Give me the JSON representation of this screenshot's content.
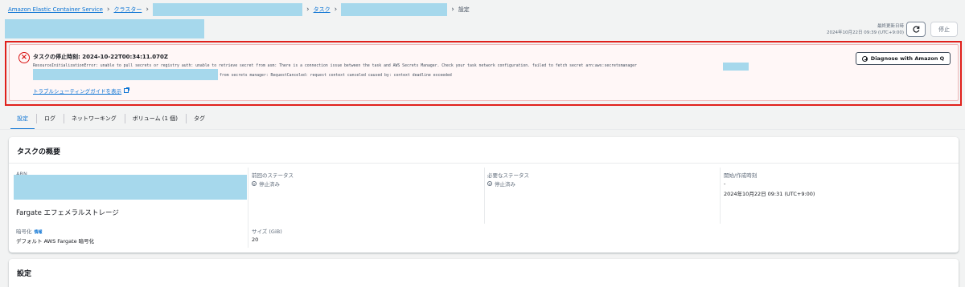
{
  "breadcrumb": {
    "service": "Amazon Elastic Container Service",
    "clusters": "クラスター",
    "tasks": "タスク",
    "current": "設定"
  },
  "header": {
    "last_updated_label": "最終更新日時",
    "last_updated_value": "2024年10月22日 09:39 (UTC+9:00)",
    "stop_label": "停止"
  },
  "alert": {
    "title": "タスクの停止時刻: 2024-10-22T00:34:11.070Z",
    "message_line1": "ResourceInitializationError: unable to pull secrets or registry auth: unable to retrieve secret from asm: There is a connection issue between the task and AWS Secrets Manager. Check your task network configuration. failed to fetch secret arn:aws:secretsmanager",
    "message_line2": "from secrets manager: RequestCanceled: request context canceled caused by: context deadline exceeded",
    "troubleshoot_link": "トラブルシューティングガイドを表示",
    "diagnose_label": "Diagnose with Amazon Q"
  },
  "tabs": [
    {
      "label": "設定",
      "active": true
    },
    {
      "label": "ログ",
      "active": false
    },
    {
      "label": "ネットワーキング",
      "active": false
    },
    {
      "label": "ボリューム (1 個)",
      "active": false
    },
    {
      "label": "タグ",
      "active": false
    }
  ],
  "summary": {
    "title": "タスクの概要",
    "arn_label": "ARN",
    "prev_status_label": "前回のステータス",
    "prev_status_value": "停止済み",
    "desired_status_label": "必要なステータス",
    "desired_status_value": "停止済み",
    "started_label": "開始/作成時刻",
    "started_dash": "-",
    "started_value": "2024年10月22日 09:31 (UTC+9:00)",
    "storage_title": "Fargate エフェメラルストレージ",
    "encryption_label": "暗号化",
    "info_label": "情報",
    "encryption_value": "デフォルト AWS Fargate 暗号化",
    "size_label": "サイズ (GiB)",
    "size_value": "20"
  },
  "settings_card": {
    "title": "設定"
  },
  "colors": {
    "link": "#0972d3",
    "error": "#d91515",
    "redaction": "#a6d8ec"
  }
}
